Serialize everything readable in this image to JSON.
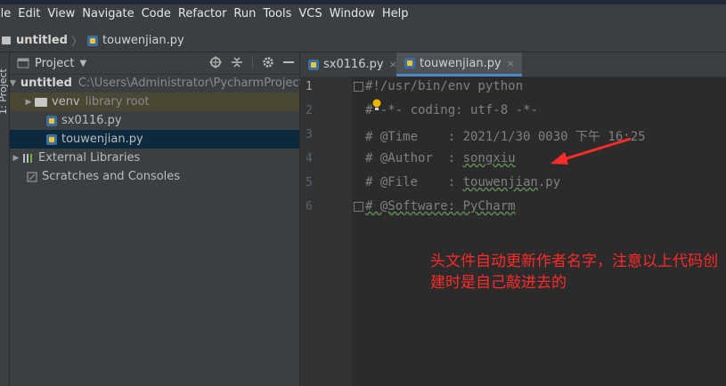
{
  "menu": [
    "ile",
    "Edit",
    "View",
    "Navigate",
    "Code",
    "Refactor",
    "Run",
    "Tools",
    "VCS",
    "Window",
    "Help"
  ],
  "nav": {
    "project": "untitled",
    "file": "touwenjian.py"
  },
  "side_tab": "1: Project",
  "panel": {
    "title": "Project",
    "tree": [
      {
        "name": "untitled",
        "path": "C:\\Users\\Administrator\\PycharmProjects"
      },
      {
        "name": "venv",
        "note": "library root"
      },
      {
        "name": "sx0116.py"
      },
      {
        "name": "touwenjian.py"
      },
      {
        "name": "External Libraries"
      },
      {
        "name": "Scratches and Consoles"
      }
    ]
  },
  "tabs": [
    {
      "label": "sx0116.py",
      "close": "×"
    },
    {
      "label": "touwenjian.py",
      "close": "×"
    }
  ],
  "code": [
    {
      "no": "1",
      "text": "#!/usr/bin/env python"
    },
    {
      "no": "2",
      "text": "# -*- coding: utf-8 -*-"
    },
    {
      "no": "3",
      "text": "# @Time    : 2021/1/30 0030 下午 16:25"
    },
    {
      "no": "4",
      "label": "# @Author  : ",
      "value": "songxiu"
    },
    {
      "no": "5",
      "label": "# @File    : ",
      "value": "touwenjian",
      "ext": ".py"
    },
    {
      "no": "6",
      "text": "# @Software: PyCharm"
    }
  ],
  "annotation": "头文件自动更新作者名字，注意以上代码创建时是自己敲进去的",
  "colors": {
    "annotation": "#ff2a2a",
    "selection": "#0d293e",
    "tab_underline": "#4a88c7"
  }
}
